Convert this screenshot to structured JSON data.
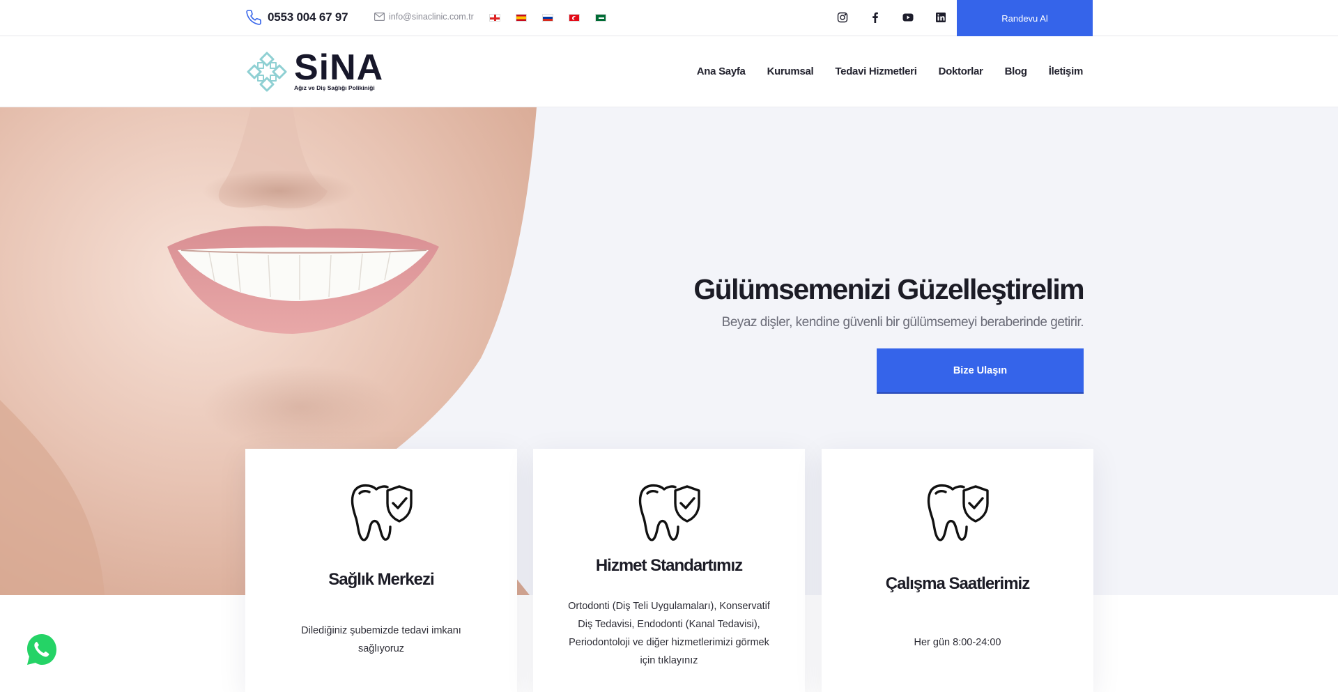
{
  "topbar": {
    "phone": "0553 004 67 97",
    "email": "info@sinaclinic.com.tr",
    "flags": [
      "english-flag",
      "spanish-flag",
      "russian-flag",
      "turkish-flag",
      "arabic-flag"
    ],
    "social": [
      "instagram-icon",
      "facebook-icon",
      "youtube-icon",
      "linkedin-icon"
    ],
    "appointment_button": "Randevu Al"
  },
  "header": {
    "logo_text": "SiNA",
    "logo_subtitle": "Ağız ve Diş Sağlığı Polikiniği",
    "nav": [
      "Ana Sayfa",
      "Kurumsal",
      "Tedavi Hizmetleri",
      "Doktorlar",
      "Blog",
      "İletişim"
    ]
  },
  "hero": {
    "title": "Gülümsemenizi Güzelleştirelim",
    "subtitle": "Beyaz dişler, kendine güvenli bir gülümsemeyi beraberinde getirir.",
    "button": "Bize Ulaşın"
  },
  "cards": [
    {
      "icon": "tooth-shield-icon",
      "title": "Sağlık Merkezi",
      "text": "Dilediğiniz şubemizde tedavi imkanı sağlıyoruz"
    },
    {
      "icon": "tooth-shield-icon",
      "title": "Hizmet Standartımız",
      "text": "Ortodonti (Diş Teli Uygulamaları), Konservatif Diş Tedavisi, Endodonti (Kanal Tedavisi), Periodontoloji ve diğer hizmetlerimizi görmek için tıklayınız"
    },
    {
      "icon": "tooth-shield-icon",
      "title": "Çalışma Saatlerimiz",
      "text": "Her gün 8:00-24:00"
    }
  ],
  "colors": {
    "accent": "#3564ea",
    "text_dark": "#1c1c26",
    "hero_bg": "#f3f4f9",
    "whatsapp": "#25d366"
  }
}
